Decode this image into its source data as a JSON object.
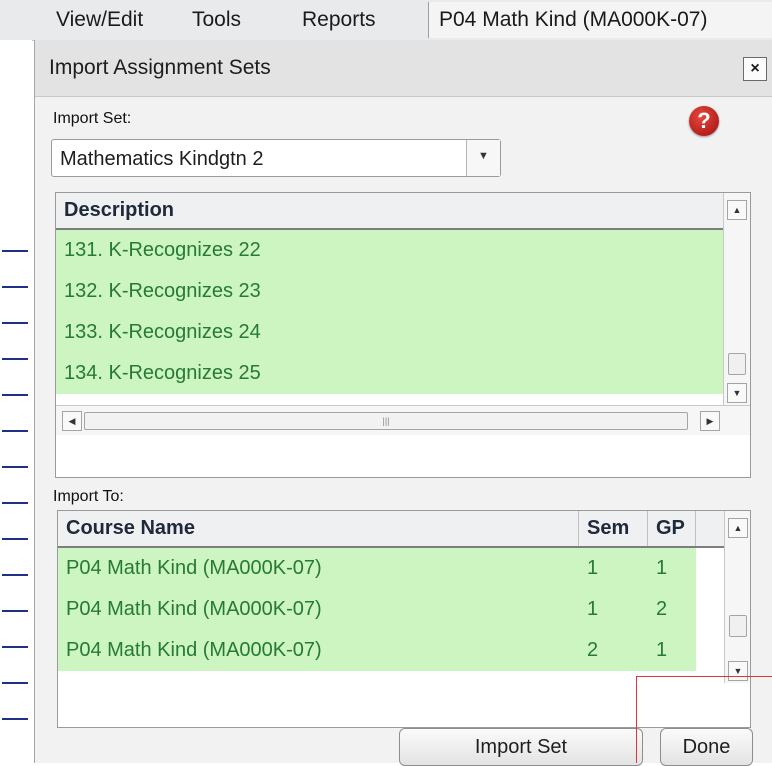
{
  "menubar": {
    "items": [
      "View/Edit",
      "Tools",
      "Reports"
    ],
    "course": "P04  Math Kind (MA000K-07)"
  },
  "dialog": {
    "title": "Import Assignment Sets",
    "close_label": "×",
    "help_label": "?",
    "import_set_label": "Import Set:",
    "import_set_value": "Mathematics Kindgtn 2",
    "description_header": "Description",
    "descriptions": [
      "131. K-Recognizes 22",
      "132. K-Recognizes 23",
      "133. K-Recognizes 24",
      "134. K-Recognizes 25"
    ],
    "import_to_label": "Import To:",
    "course_headers": {
      "name": "Course Name",
      "sem": "Sem",
      "gp": "GP"
    },
    "courses": [
      {
        "name": "P04  Math Kind (MA000K-07)",
        "sem": "1",
        "gp": "1"
      },
      {
        "name": "P04  Math Kind (MA000K-07)",
        "sem": "1",
        "gp": "2"
      },
      {
        "name": "P04  Math Kind (MA000K-07)",
        "sem": "2",
        "gp": "1"
      }
    ],
    "import_button": "Import Set",
    "done_button": "Done"
  },
  "colors": {
    "row_bg": "#ccf5c1",
    "row_text": "#267a33",
    "focus": "#d9363e"
  }
}
